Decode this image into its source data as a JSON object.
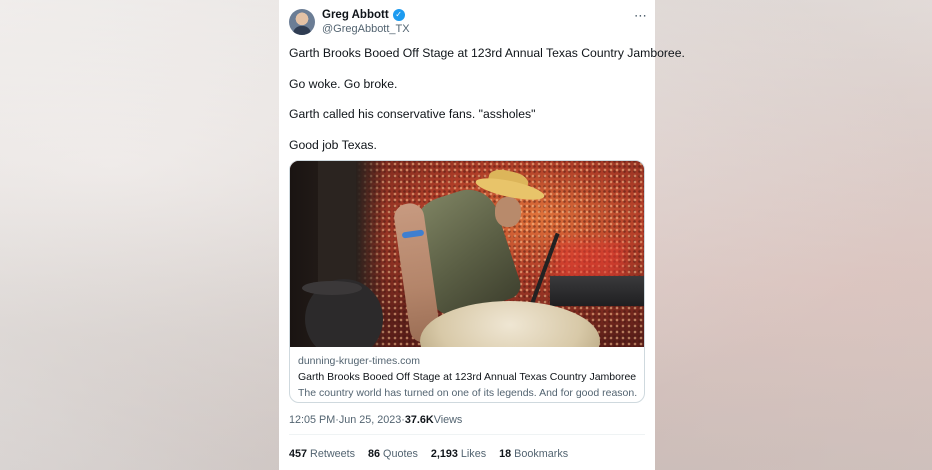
{
  "tweet": {
    "author_name": "Greg Abbott",
    "verified_mark": "✓",
    "handle": "@GregAbbott_TX",
    "more_icon": "⋯",
    "lines": [
      "Garth Brooks Booed Off Stage at 123rd Annual Texas Country Jamboree.",
      "Go woke. Go broke.",
      "Garth called his conservative fans. \"assholes\"",
      "Good job Texas."
    ]
  },
  "link_card": {
    "domain": "dunning-kruger-times.com",
    "title": "Garth Brooks Booed Off Stage at 123rd Annual Texas Country Jamboree",
    "description": "The country world has turned on one of its legends. And for good reason."
  },
  "meta": {
    "time": "12:05 PM",
    "sep1": " · ",
    "date": "Jun 25, 2023",
    "sep2": " · ",
    "views_count": "37.6K",
    "views_label": " Views"
  },
  "stats": [
    {
      "count": "457",
      "label": "Retweets"
    },
    {
      "count": "86",
      "label": "Quotes"
    },
    {
      "count": "2,193",
      "label": "Likes"
    },
    {
      "count": "18",
      "label": "Bookmarks"
    }
  ],
  "colors": {
    "verified": "#1d9bf0",
    "text_primary": "#0f1419",
    "text_secondary": "#536471"
  }
}
